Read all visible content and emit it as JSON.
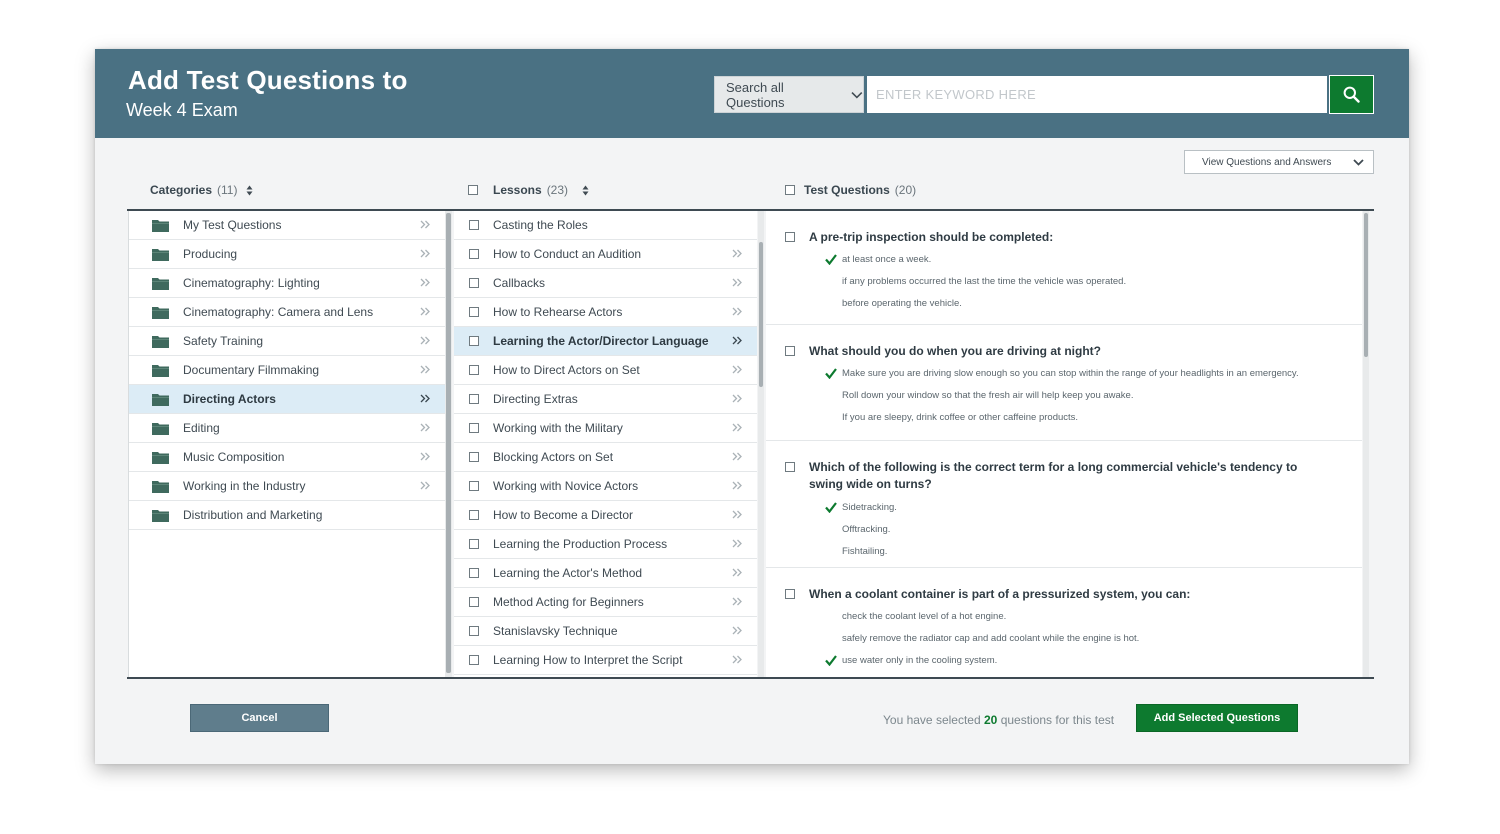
{
  "header": {
    "title": "Add Test Questions to",
    "subtitle": "Week 4 Exam",
    "search_scope": "Search all Questions",
    "search_placeholder": "ENTER KEYWORD HERE"
  },
  "view_select": "View Questions and Answers",
  "columns": {
    "categories": {
      "label": "Categories",
      "count": "(11)"
    },
    "lessons": {
      "label": "Lessons",
      "count": "(23)"
    },
    "questions": {
      "label": "Test Questions",
      "count": "(20)"
    }
  },
  "categories": [
    {
      "label": "My Test Questions"
    },
    {
      "label": "Producing"
    },
    {
      "label": "Cinematography: Lighting"
    },
    {
      "label": "Cinematography: Camera and Lens"
    },
    {
      "label": "Safety Training"
    },
    {
      "label": "Documentary Filmmaking"
    },
    {
      "label": "Directing Actors"
    },
    {
      "label": "Editing"
    },
    {
      "label": "Music Composition"
    },
    {
      "label": "Working in the Industry"
    },
    {
      "label": "Distribution and Marketing"
    }
  ],
  "selected_category": 6,
  "lessons": [
    {
      "label": "Casting the Roles"
    },
    {
      "label": "How to Conduct an Audition"
    },
    {
      "label": "Callbacks"
    },
    {
      "label": "How to Rehearse Actors"
    },
    {
      "label": "Learning the Actor/Director Language"
    },
    {
      "label": "How to Direct Actors on Set"
    },
    {
      "label": "Directing Extras"
    },
    {
      "label": "Working with the Military"
    },
    {
      "label": "Blocking Actors on Set"
    },
    {
      "label": "Working with Novice Actors"
    },
    {
      "label": "How to Become a Director"
    },
    {
      "label": "Learning the Production Process"
    },
    {
      "label": "Learning the Actor's Method"
    },
    {
      "label": "Method Acting for Beginners"
    },
    {
      "label": "Stanislavsky Technique"
    },
    {
      "label": "Learning How to Interpret the Script"
    }
  ],
  "selected_lesson": 4,
  "questions": [
    {
      "text": "A pre-trip inspection should be completed:",
      "answers": [
        "at least once a week.",
        "if any problems occurred the last the time the vehicle was operated.",
        "before operating the vehicle."
      ],
      "correct": 0
    },
    {
      "text": "What should you do when you are driving at night?",
      "answers": [
        "Make sure you are driving slow enough so you can stop within the range of your headlights in an emergency.",
        "Roll down your window so that the fresh air will help keep you awake.",
        "If you are sleepy, drink coffee or other caffeine products."
      ],
      "correct": 0
    },
    {
      "text": "Which of the following is the correct term for a long commercial vehicle's tendency to swing wide on turns?",
      "answers": [
        "Sidetracking.",
        "Offtracking.",
        "Fishtailing."
      ],
      "correct": 0
    },
    {
      "text": "When a coolant container is part of a pressurized system, you can:",
      "answers": [
        "check the coolant level of a hot engine.",
        "safely remove the radiator cap and add coolant while the engine is hot.",
        "use water only in the cooling system."
      ],
      "correct": 2
    }
  ],
  "footer": {
    "cancel": "Cancel",
    "selection_prefix": "You have selected",
    "selection_count": "20",
    "selection_suffix": "questions for this test",
    "add": "Add Selected Questions"
  },
  "colors": {
    "header": "#4a7183",
    "primary_green": "#0d7a2f",
    "selected_row": "#dcecf6",
    "cancel": "#5f7d8c"
  }
}
